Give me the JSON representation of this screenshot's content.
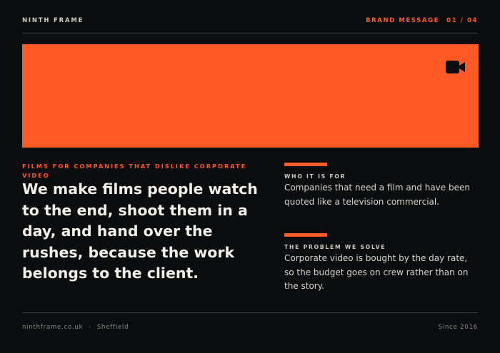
{
  "header": {
    "brand": "NINTH FRAME",
    "section": "BRAND MESSAGE",
    "page": "01 / 04"
  },
  "hero": {
    "accent_color": "#ff5a26",
    "icon": "video-camera-icon"
  },
  "intro": {
    "kicker": "FILMS FOR COMPANIES THAT DISLIKE CORPORATE VIDEO",
    "headline": "We make films people watch to the end, shoot them in a day, and hand over the rushes, because the work belongs to the client."
  },
  "blocks": [
    {
      "label": "WHO IT IS FOR",
      "body": "Companies that need a film and have been quoted like a television commercial."
    },
    {
      "label": "THE PROBLEM WE SOLVE",
      "body": "Corporate video is bought by the day rate, so the budget goes on crew rather than on the story."
    }
  ],
  "footer": {
    "website": "ninthframe.co.uk",
    "separator": "·",
    "city": "Sheffield",
    "since": "Since 2016"
  }
}
